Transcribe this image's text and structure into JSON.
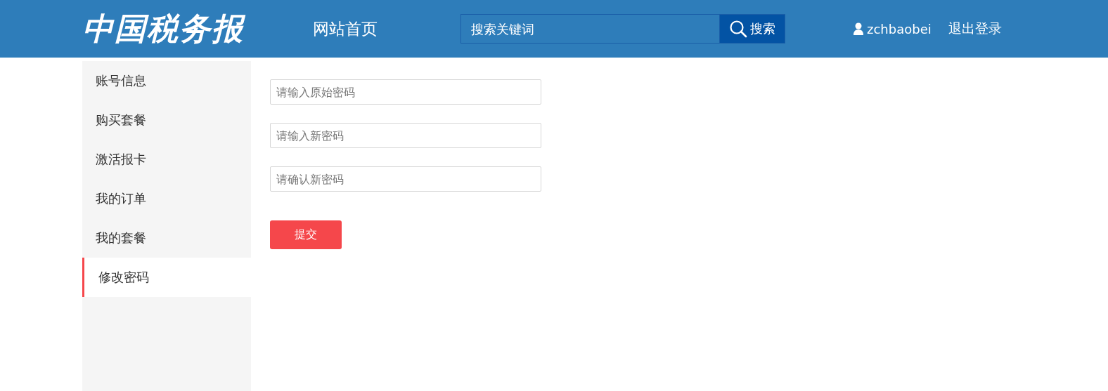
{
  "header": {
    "logo": "中国税务报",
    "nav_link": "网站首页",
    "search": {
      "placeholder": "搜索关键词",
      "button": "搜索"
    },
    "username": "zchbaobei",
    "logout": "退出登录"
  },
  "sidebar": {
    "items": [
      {
        "label": "账号信息",
        "selected": false
      },
      {
        "label": "购买套餐",
        "selected": false
      },
      {
        "label": "激活报卡",
        "selected": false
      },
      {
        "label": "我的订单",
        "selected": false
      },
      {
        "label": "我的套餐",
        "selected": false
      },
      {
        "label": "修改密码",
        "selected": true
      }
    ]
  },
  "form": {
    "fields": [
      {
        "placeholder": "请输入原始密码"
      },
      {
        "placeholder": "请输入新密码"
      },
      {
        "placeholder": "请确认新密码"
      }
    ],
    "submit": "提交"
  }
}
